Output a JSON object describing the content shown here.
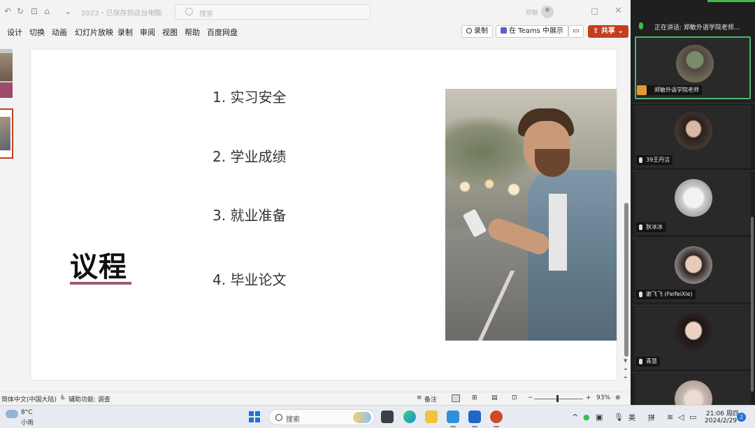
{
  "window": {
    "doc_title": "2023・已保存到这台电脑",
    "search_placeholder": "搜索",
    "user_name": "郑敏"
  },
  "ribbon": {
    "tabs": [
      "设计",
      "切换",
      "动画",
      "幻灯片放映",
      "录制",
      "审阅",
      "视图",
      "帮助",
      "百度网盘"
    ],
    "record_label": "录制",
    "teams_label": "在 Teams 中展示",
    "share_label": "共享"
  },
  "slide": {
    "title": "议程",
    "agenda": [
      "1. 实习安全",
      "2. 学业成绩",
      "3. 就业准备",
      "4. 毕业论文"
    ],
    "accent_color": "#9b5a78"
  },
  "statusbar": {
    "language": "简体中文(中国大陆)",
    "accessibility": "辅助功能: 调查",
    "notes": "备注",
    "zoom": "93%"
  },
  "teams": {
    "speaking_label": "正在讲话: 郑敏外语学院老师...",
    "participants": [
      {
        "name": "郑敏外语学院老师",
        "active": true
      },
      {
        "name": "39王丹洁",
        "active": false
      },
      {
        "name": "狄冰冰",
        "active": false
      },
      {
        "name": "谢飞飞 (FeifeiXie)",
        "active": false
      },
      {
        "name": "青慧",
        "active": false
      }
    ]
  },
  "taskbar": {
    "weather_temp": "8°C",
    "weather_desc": "小雨",
    "search_label": "搜索",
    "ime_lang": "英",
    "ime_mode": "拼",
    "time": "21:06 周四",
    "date": "2024/2/29",
    "notifications": "2"
  }
}
